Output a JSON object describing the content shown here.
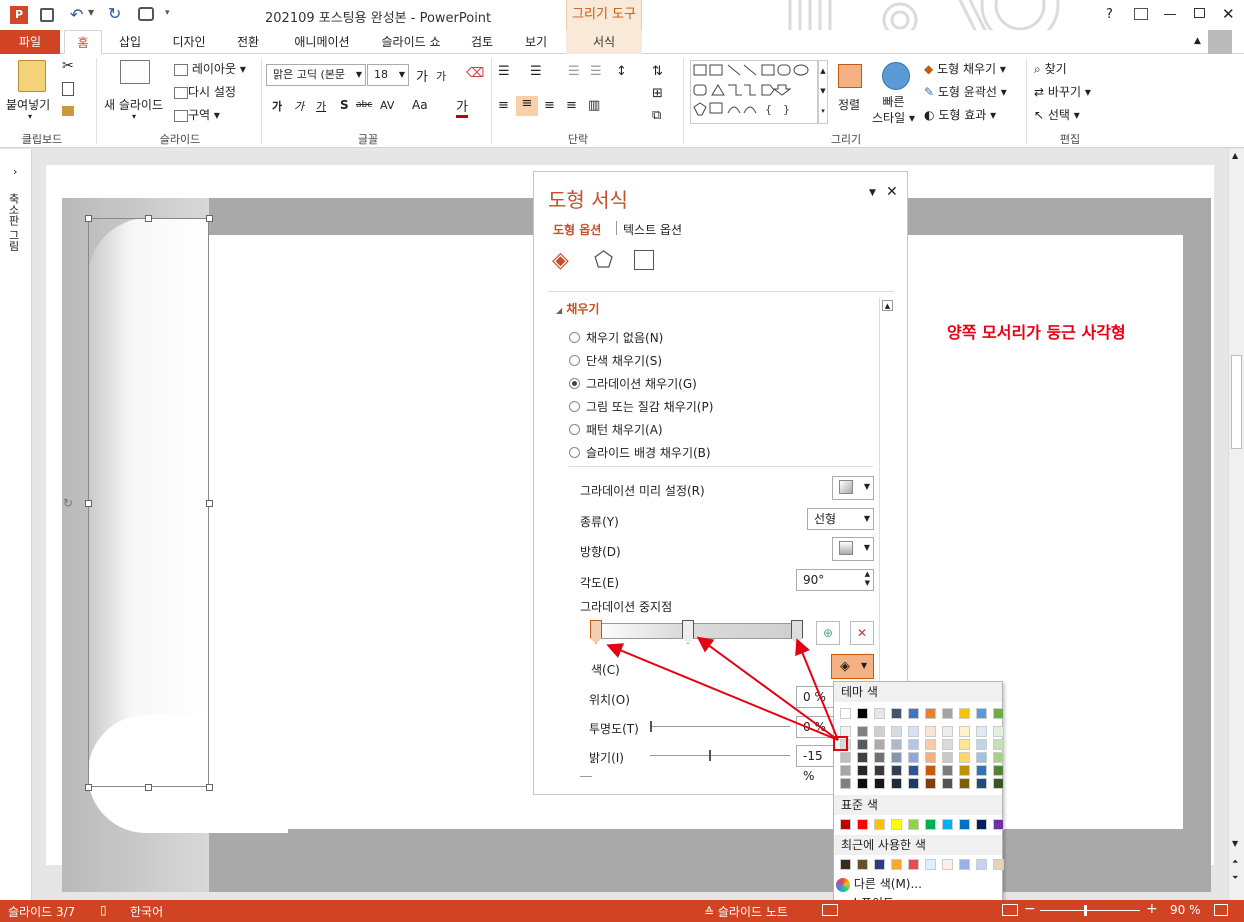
{
  "window": {
    "title": "202109 포스팅용 완성본 - PowerPoint",
    "context_tab_group": "그리기 도구",
    "help": "?"
  },
  "tabs": [
    "파일",
    "홈",
    "삽입",
    "디자인",
    "전환",
    "애니메이션",
    "슬라이드 쇼",
    "검토",
    "보기",
    "서식"
  ],
  "ribbon": {
    "clipboard": {
      "paste": "붙여넣기",
      "label": "클립보드"
    },
    "slides": {
      "new_slide": "새 슬라이드",
      "layout": "레이아웃",
      "reset": "다시 설정",
      "section": "구역",
      "label": "슬라이드"
    },
    "font": {
      "name": "맑은 고딕 (본문",
      "size": "18",
      "label": "글꼴",
      "bold": "가",
      "italic": "가",
      "underline": "가",
      "shadow": "S",
      "strike": "abc",
      "spacing": "AV",
      "case": "Aa",
      "color": "가",
      "grow": "가",
      "shrink": "가"
    },
    "paragraph": {
      "label": "단락"
    },
    "drawing": {
      "arrange": "정렬",
      "quick_styles_1": "빠른",
      "quick_styles_2": "스타일",
      "fill": "도형 채우기",
      "outline": "도형 윤곽선",
      "effects": "도형 효과",
      "label": "그리기"
    },
    "editing": {
      "find": "찾기",
      "replace": "바꾸기",
      "select": "선택",
      "label": "편집"
    }
  },
  "thumb_pane": {
    "label": "축소판 그림"
  },
  "slide": {
    "annotation": "양쪽 모서리가 둥근 사각형",
    "annotation_color": "#e60012"
  },
  "format_pane": {
    "title": "도형 서식",
    "tab_shape": "도형 옵션",
    "tab_text": "텍스트 옵션",
    "section": "채우기",
    "fill_options": [
      "채우기 없음(N)",
      "단색 채우기(S)",
      "그라데이션 채우기(G)",
      "그림 또는 질감 채우기(P)",
      "패턴 채우기(A)",
      "슬라이드 배경 채우기(B)"
    ],
    "selected_fill": 2,
    "preset_label": "그라데이션 미리 설정(R)",
    "type_label": "종류(Y)",
    "type_value": "선형",
    "direction_label": "방향(D)",
    "angle_label": "각도(E)",
    "angle_value": "90°",
    "stops_label": "그라데이션 중지점",
    "color_label": "색(C)",
    "position_label": "위치(O)",
    "position_value": "0 %",
    "transparency_label": "투명도(T)",
    "transparency_value": "0 %",
    "brightness_label": "밝기(I)",
    "brightness_value": "-15 %"
  },
  "palette": {
    "theme_label": "테마 색",
    "standard_label": "표준 색",
    "recent_label": "최근에 사용한 색",
    "more_colors": "다른 색(M)...",
    "eyedropper": "스포이트",
    "theme_top": [
      "#ffffff",
      "#000000",
      "#e7e6e6",
      "#44546a",
      "#4472c4",
      "#ed7d31",
      "#a5a5a5",
      "#ffc000",
      "#5b9bd5",
      "#70ad47"
    ],
    "theme_shades": [
      [
        "#f2f2f2",
        "#d9d9d9",
        "#bfbfbf",
        "#a6a6a6",
        "#808080"
      ],
      [
        "#808080",
        "#595959",
        "#404040",
        "#262626",
        "#0d0d0d"
      ],
      [
        "#d0cece",
        "#aeabab",
        "#757070",
        "#3a3838",
        "#171616"
      ],
      [
        "#d6dce4",
        "#adb9ca",
        "#8496b0",
        "#333f50",
        "#222a35"
      ],
      [
        "#d9e2f3",
        "#b4c6e7",
        "#8eaadb",
        "#2f5496",
        "#1f3864"
      ],
      [
        "#fbe4d5",
        "#f7caac",
        "#f4b083",
        "#c55a11",
        "#833c0b"
      ],
      [
        "#ededed",
        "#dbdbdb",
        "#c9c9c9",
        "#7b7b7b",
        "#525252"
      ],
      [
        "#fff2cc",
        "#fee599",
        "#ffd965",
        "#bf9000",
        "#7f6000"
      ],
      [
        "#deeaf6",
        "#bdd6ee",
        "#9cc2e5",
        "#2e75b5",
        "#1f4e79"
      ],
      [
        "#e2efd9",
        "#c5e0b3",
        "#a8d08d",
        "#538135",
        "#375623"
      ]
    ],
    "standard": [
      "#c00000",
      "#ff0000",
      "#ffc000",
      "#ffff00",
      "#92d050",
      "#00b050",
      "#00b0f0",
      "#0070c0",
      "#002060",
      "#7030a0"
    ],
    "recent": [
      "#3b2a1a",
      "#6b4f2a",
      "#2e3a87",
      "#f4a83a",
      "#e05050",
      "#ddeefc",
      "#fdeee6",
      "#9aaee8",
      "#c6d3f0",
      "#e5d2b8"
    ]
  },
  "status": {
    "slide": "슬라이드 3/7",
    "lang": "한국어",
    "notes": "슬라이드 노트",
    "zoom": "90 %"
  }
}
